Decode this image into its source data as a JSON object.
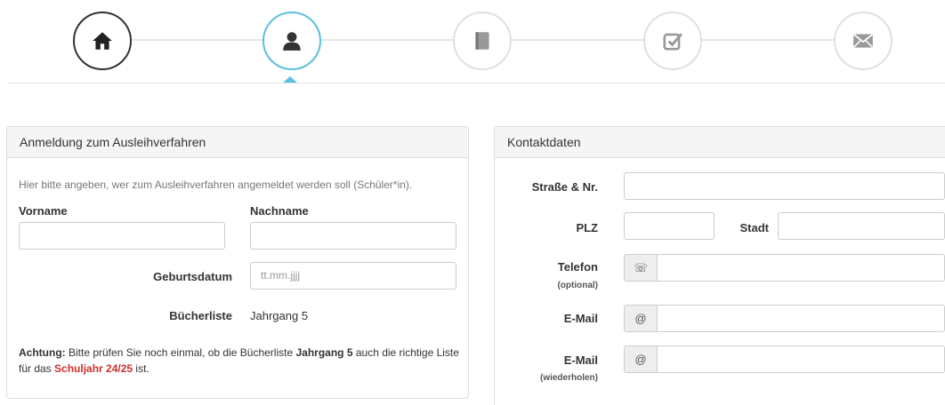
{
  "wizard": {
    "steps": [
      {
        "icon": "home-icon",
        "state": "done"
      },
      {
        "icon": "user-icon",
        "state": "active"
      },
      {
        "icon": "book-icon",
        "state": "upcoming"
      },
      {
        "icon": "check-square-icon",
        "state": "upcoming"
      },
      {
        "icon": "envelope-icon",
        "state": "upcoming"
      }
    ]
  },
  "registration": {
    "title": "Anmeldung zum Ausleihverfahren",
    "hint": "Hier bitte angeben, wer zum Ausleihverfahren angemeldet werden soll (Schüler*in).",
    "first_name_label": "Vorname",
    "last_name_label": "Nachname",
    "birthdate_label": "Geburtsdatum",
    "birthdate_placeholder": "tt.mm.jjjj",
    "booklist_label": "Bücherliste",
    "booklist_value": "Jahrgang 5",
    "notice": {
      "prefix": "Achtung:",
      "text1": " Bitte prüfen Sie noch einmal, ob die Bücherliste ",
      "grade": "Jahrgang 5",
      "text2": " auch die richtige Liste für das ",
      "school_year": "Schuljahr 24/25",
      "text3": " ist."
    }
  },
  "contact": {
    "title": "Kontaktdaten",
    "street_label": "Straße & Nr.",
    "zip_label": "PLZ",
    "city_label": "Stadt",
    "phone_label": "Telefon",
    "phone_sub": "(optional)",
    "phone_addon": "☏",
    "email_label": "E-Mail",
    "email_addon": "@",
    "email_repeat_label": "E-Mail",
    "email_repeat_sub": "(wiederholen)",
    "email_repeat_addon": "@"
  },
  "colors": {
    "active_step": "#5bc0de",
    "done_step": "#333333",
    "warning_text": "#c9302c"
  }
}
